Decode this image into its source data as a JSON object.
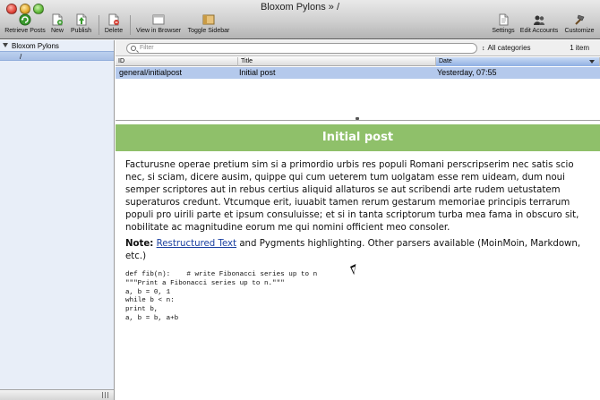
{
  "window": {
    "title": "Bloxom Pylons » /"
  },
  "toolbar": {
    "retrieve_label": "Retrieve Posts",
    "new_label": "New",
    "publish_label": "Publish",
    "delete_label": "Delete",
    "view_label": "View in Browser",
    "toggle_label": "Toggle Sidebar",
    "settings_label": "Settings",
    "accounts_label": "Edit Accounts",
    "customize_label": "Customize"
  },
  "sidebar": {
    "root_label": "Bloxom Pylons",
    "child_label": "/"
  },
  "filter": {
    "placeholder": "Filter",
    "category": "All categories",
    "count": "1 item"
  },
  "table": {
    "columns": [
      "ID",
      "Title",
      "Date"
    ],
    "rows": [
      {
        "id": "general/initialpost",
        "title": "Initial post",
        "date": "Yesterday, 07:55"
      }
    ]
  },
  "post": {
    "title": "Initial post",
    "body": "Facturusne operae pretium sim si a primordio urbis res populi Romani perscripserim nec satis scio nec, si sciam, dicere ausim, quippe qui cum ueterem tum uolgatam esse rem uideam, dum noui semper scriptores aut in rebus certius aliquid allaturos se aut scribendi arte rudem uetustatem superaturos credunt. Vtcumque erit, iuuabit tamen rerum gestarum memoriae principis terrarum populi pro uirili parte et ipsum consuluisse; et si in tanta scriptorum turba mea fama in obscuro sit, nobilitate ac magnitudine eorum me qui nomini officient meo consoler.",
    "note_label": "Note:",
    "note_link": "Restructured Text",
    "note_rest": " and Pygments highlighting. Other parsers available (MoinMoin, Markdown, etc.)",
    "code": "def fib(n):    # write Fibonacci series up to n\n\"\"\"Print a Fibonacci series up to n.\"\"\"\na, b = 0, 1\nwhile b < n:\nprint b,\na, b = b, a+b"
  },
  "colors": {
    "header_green": "#8fc06a",
    "selection_blue": "#b4c9ec",
    "link_blue": "#1a3fa0"
  }
}
